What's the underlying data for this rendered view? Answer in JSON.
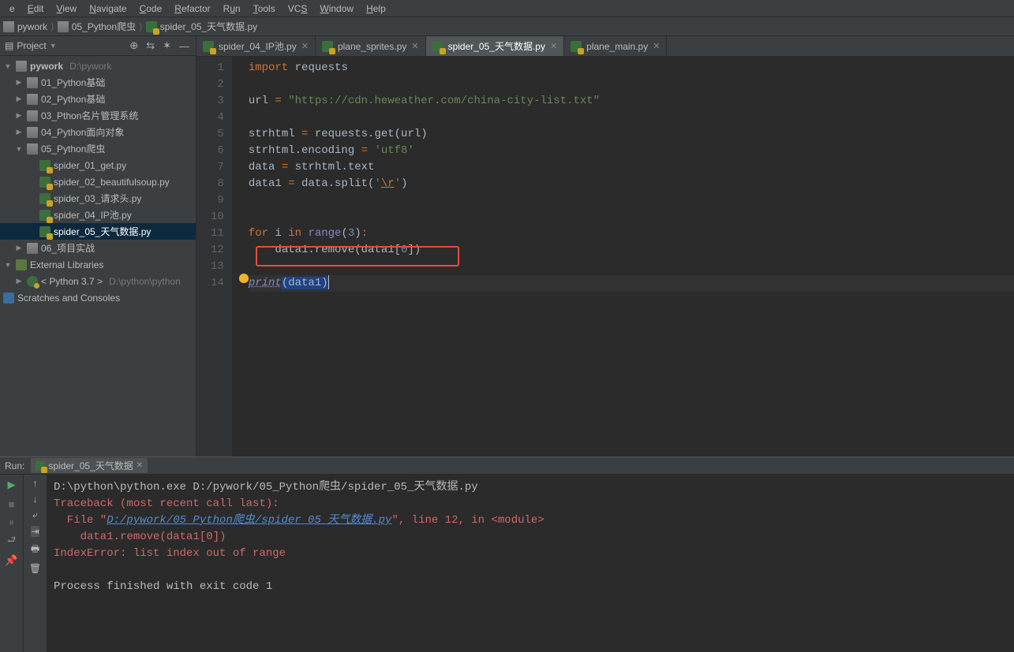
{
  "menu": [
    "File",
    "Edit",
    "View",
    "Navigate",
    "Code",
    "Refactor",
    "Run",
    "Tools",
    "VCS",
    "Window",
    "Help"
  ],
  "menu_accel": [
    "",
    "E",
    "V",
    "N",
    "C",
    "R",
    "",
    "T",
    "",
    "W",
    "H"
  ],
  "breadcrumbs": {
    "project": "pywork",
    "folder": "05_Python爬虫",
    "file": "spider_05_天气数据.py"
  },
  "project_panel": {
    "title": "Project",
    "root": "pywork",
    "root_hint": "D:\\pywork",
    "folders": [
      "01_Python基础",
      "02_Python基础",
      "03_Pthon名片管理系统",
      "04_Python面向对象",
      "05_Python爬虫",
      "06_项目实战"
    ],
    "spider_files": [
      "spider_01_get.py",
      "spider_02_beautifulsoup.py",
      "spider_03_请求头.py",
      "spider_04_IP池.py",
      "spider_05_天气数据.py"
    ],
    "ext_lib": "External Libraries",
    "python_env": "< Python 3.7 >",
    "python_env_hint": "D:\\python\\python",
    "scratches": "Scratches and Consoles"
  },
  "tabs": [
    {
      "label": "spider_04_IP池.py",
      "active": false
    },
    {
      "label": "plane_sprites.py",
      "active": false
    },
    {
      "label": "spider_05_天气数据.py",
      "active": true
    },
    {
      "label": "plane_main.py",
      "active": false
    }
  ],
  "code": {
    "lines": [
      "1",
      "2",
      "3",
      "4",
      "5",
      "6",
      "7",
      "8",
      "9",
      "10",
      "11",
      "12",
      "13",
      "14"
    ],
    "l1_kw": "import",
    "l1_mod": "requests",
    "l3_a": "url ",
    "l3_op": "= ",
    "l3_str": "\"https://cdn.heweather.com/china-city-list.txt\"",
    "l5_a": "strhtml ",
    "l5_op": "= ",
    "l5_b": "requests.get(url)",
    "l6_a": "strhtml.encoding ",
    "l6_op": "= ",
    "l6_str": "'utf8'",
    "l7_a": "data ",
    "l7_op": "= ",
    "l7_b": "strhtml.text",
    "l8_a": "data1 ",
    "l8_op": "= ",
    "l8_b": "data.split(",
    "l8_q": "'",
    "l8_esc": "\\r",
    "l8_q2": "'",
    "l8_c": ")",
    "l11_for": "for ",
    "l11_i": "i ",
    "l11_in": "in ",
    "l11_range": "range",
    "l11_p": "(",
    "l11_n": "3",
    "l11_p2": ")",
    "l11_col": ":",
    "l12_a": "    data1.remove(data1[",
    "l12_n": "0",
    "l12_b": "])",
    "l14_print": "print",
    "l14_a": "(data1",
    "l14_b": ")"
  },
  "run": {
    "label": "Run:",
    "tab": "spider_05_天气数据",
    "line1": "D:\\python\\python.exe D:/pywork/05_Python爬虫/spider_05_天气数据.py",
    "trace": "Traceback (most recent call last):",
    "file_pre": "  File \"",
    "file_link": "D:/pywork/05_Python爬虫/spider_05_天气数据.py",
    "file_post": "\", line 12, in <module>",
    "code_line": "    data1.remove(data1[0])",
    "error": "IndexError: list index out of range",
    "exit": "Process finished with exit code 1"
  }
}
